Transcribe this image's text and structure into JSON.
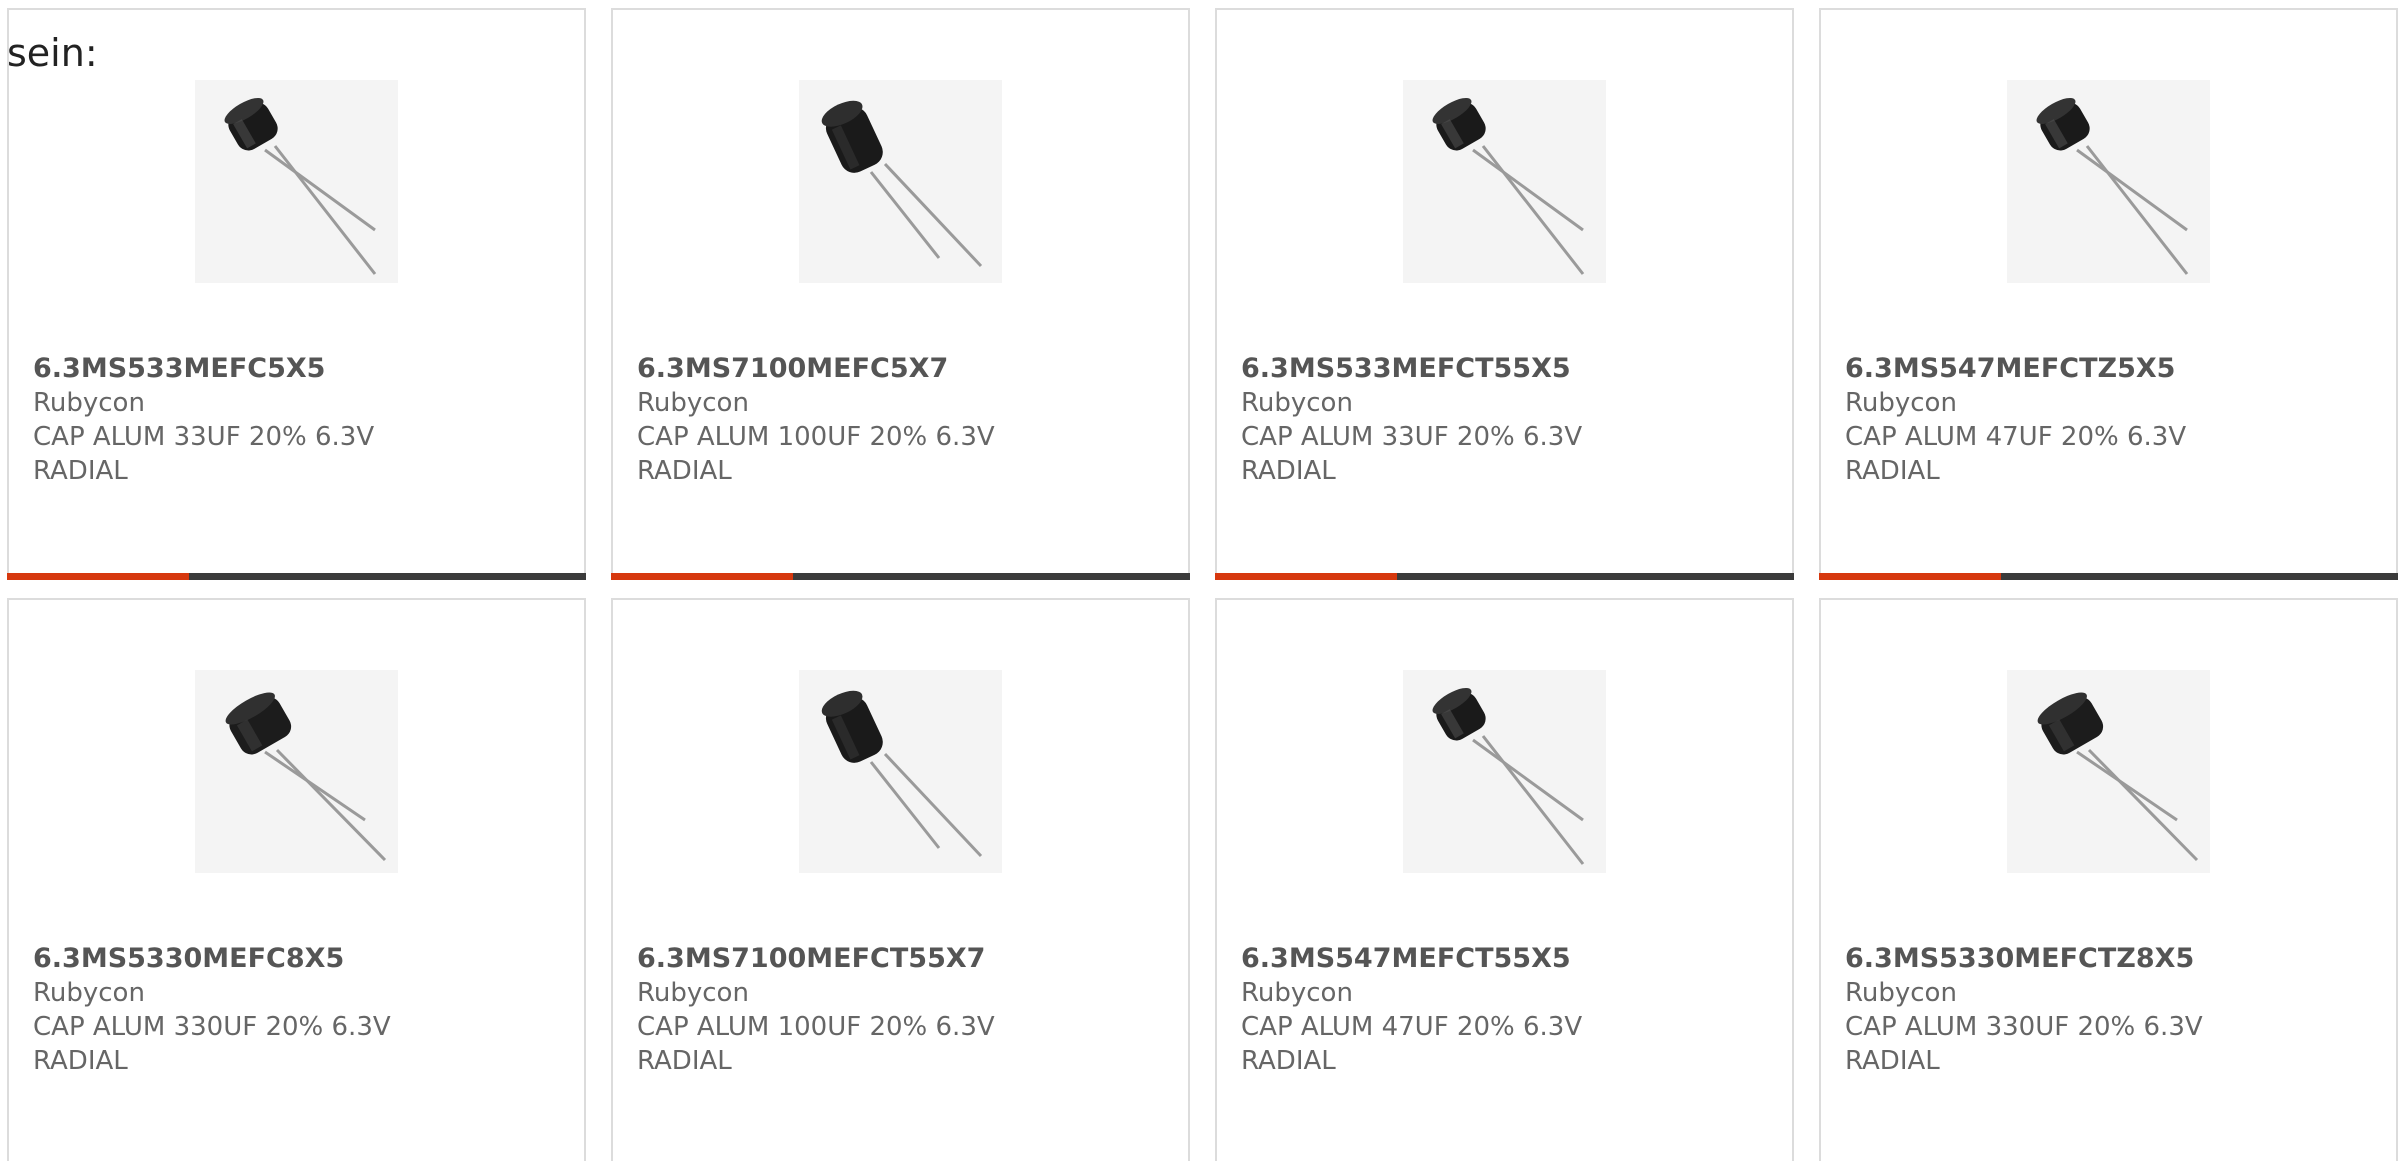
{
  "intro_text": "sein:",
  "colors": {
    "accent": "#d6380e",
    "bar": "#3b3b3b",
    "text": "#666666"
  },
  "products": [
    {
      "part": "6.3MS533MEFC5X5",
      "mfr": "Rubycon",
      "desc1": "CAP ALUM 33UF 20% 6.3V",
      "desc2": "RADIAL",
      "image": "capacitor-small-icon"
    },
    {
      "part": "6.3MS7100MEFC5X7",
      "mfr": "Rubycon",
      "desc1": "CAP ALUM 100UF 20% 6.3V",
      "desc2": "RADIAL",
      "image": "capacitor-tall-icon"
    },
    {
      "part": "6.3MS533MEFCT55X5",
      "mfr": "Rubycon",
      "desc1": "CAP ALUM 33UF 20% 6.3V",
      "desc2": "RADIAL",
      "image": "capacitor-small-icon"
    },
    {
      "part": "6.3MS547MEFCTZ5X5",
      "mfr": "Rubycon",
      "desc1": "CAP ALUM 47UF 20% 6.3V",
      "desc2": "RADIAL",
      "image": "capacitor-small-icon"
    },
    {
      "part": "6.3MS5330MEFC8X5",
      "mfr": "Rubycon",
      "desc1": "CAP ALUM 330UF 20% 6.3V",
      "desc2": "RADIAL",
      "image": "capacitor-wide-icon"
    },
    {
      "part": "6.3MS7100MEFCT55X7",
      "mfr": "Rubycon",
      "desc1": "CAP ALUM 100UF 20% 6.3V",
      "desc2": "RADIAL",
      "image": "capacitor-tall-icon"
    },
    {
      "part": "6.3MS547MEFCT55X5",
      "mfr": "Rubycon",
      "desc1": "CAP ALUM 47UF 20% 6.3V",
      "desc2": "RADIAL",
      "image": "capacitor-small-icon"
    },
    {
      "part": "6.3MS5330MEFCTZ8X5",
      "mfr": "Rubycon",
      "desc1": "CAP ALUM 330UF 20% 6.3V",
      "desc2": "RADIAL",
      "image": "capacitor-wide-icon"
    }
  ]
}
